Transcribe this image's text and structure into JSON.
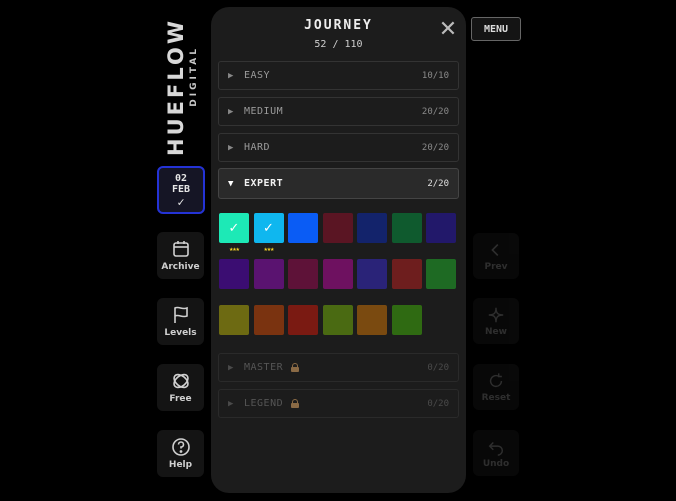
{
  "brand": {
    "main": "HUEFLOW",
    "sub": "DIGITAL"
  },
  "date": {
    "day": "02",
    "month": "FEB",
    "check": "✓"
  },
  "left_nav": [
    {
      "label": "Archive",
      "icon": "calendar-icon"
    },
    {
      "label": "Levels",
      "icon": "flag-icon"
    },
    {
      "label": "Free",
      "icon": "infinity-icon"
    },
    {
      "label": "Help",
      "icon": "question-icon"
    }
  ],
  "right_nav": [
    {
      "label": "Prev",
      "icon": "chevron-left-icon"
    },
    {
      "label": "New",
      "icon": "sparkle-icon"
    },
    {
      "label": "Reset",
      "icon": "refresh-icon"
    },
    {
      "label": "Undo",
      "icon": "undo-icon"
    }
  ],
  "menu": {
    "label": "MENU"
  },
  "modal": {
    "title": "JOURNEY",
    "progress": "52 / 110",
    "close_label": "✕",
    "categories": [
      {
        "name": "EASY",
        "count": "10/10",
        "state": "collapsed",
        "arrow": "▶"
      },
      {
        "name": "MEDIUM",
        "count": "20/20",
        "state": "collapsed",
        "arrow": "▶"
      },
      {
        "name": "HARD",
        "count": "20/20",
        "state": "collapsed",
        "arrow": "▶"
      },
      {
        "name": "EXPERT",
        "count": "2/20",
        "state": "expanded",
        "arrow": "▼"
      },
      {
        "name": "MASTER",
        "count": "0/20",
        "state": "locked",
        "arrow": "▶"
      },
      {
        "name": "LEGEND",
        "count": "0/20",
        "state": "locked",
        "arrow": "▶"
      }
    ],
    "expert_levels": [
      {
        "color": "#1de9b6",
        "completed": true,
        "stars": "★★★",
        "check": "✓"
      },
      {
        "color": "#0fb7ef",
        "completed": true,
        "stars": "★★★",
        "check": "✓"
      },
      {
        "color": "#0a5cf5",
        "completed": false
      },
      {
        "color": "#5a1523",
        "completed": false
      },
      {
        "color": "#13236b",
        "completed": false
      },
      {
        "color": "#0f5a2e",
        "completed": false
      },
      {
        "color": "#22186a",
        "completed": false
      },
      {
        "color": "#3b0d72",
        "completed": false
      },
      {
        "color": "#5a1370",
        "completed": false
      },
      {
        "color": "#5e1238",
        "completed": false
      },
      {
        "color": "#6e1160",
        "completed": false
      },
      {
        "color": "#2a2378",
        "completed": false
      },
      {
        "color": "#6e1e1e",
        "completed": false
      },
      {
        "color": "#1e6a23",
        "completed": false
      },
      {
        "color": "#6d6a12",
        "completed": false
      },
      {
        "color": "#7a3310",
        "completed": false
      },
      {
        "color": "#7a1a12",
        "completed": false
      },
      {
        "color": "#4a6a12",
        "completed": false
      },
      {
        "color": "#7a4a10",
        "completed": false
      },
      {
        "color": "#2f6a12",
        "completed": false
      }
    ]
  }
}
